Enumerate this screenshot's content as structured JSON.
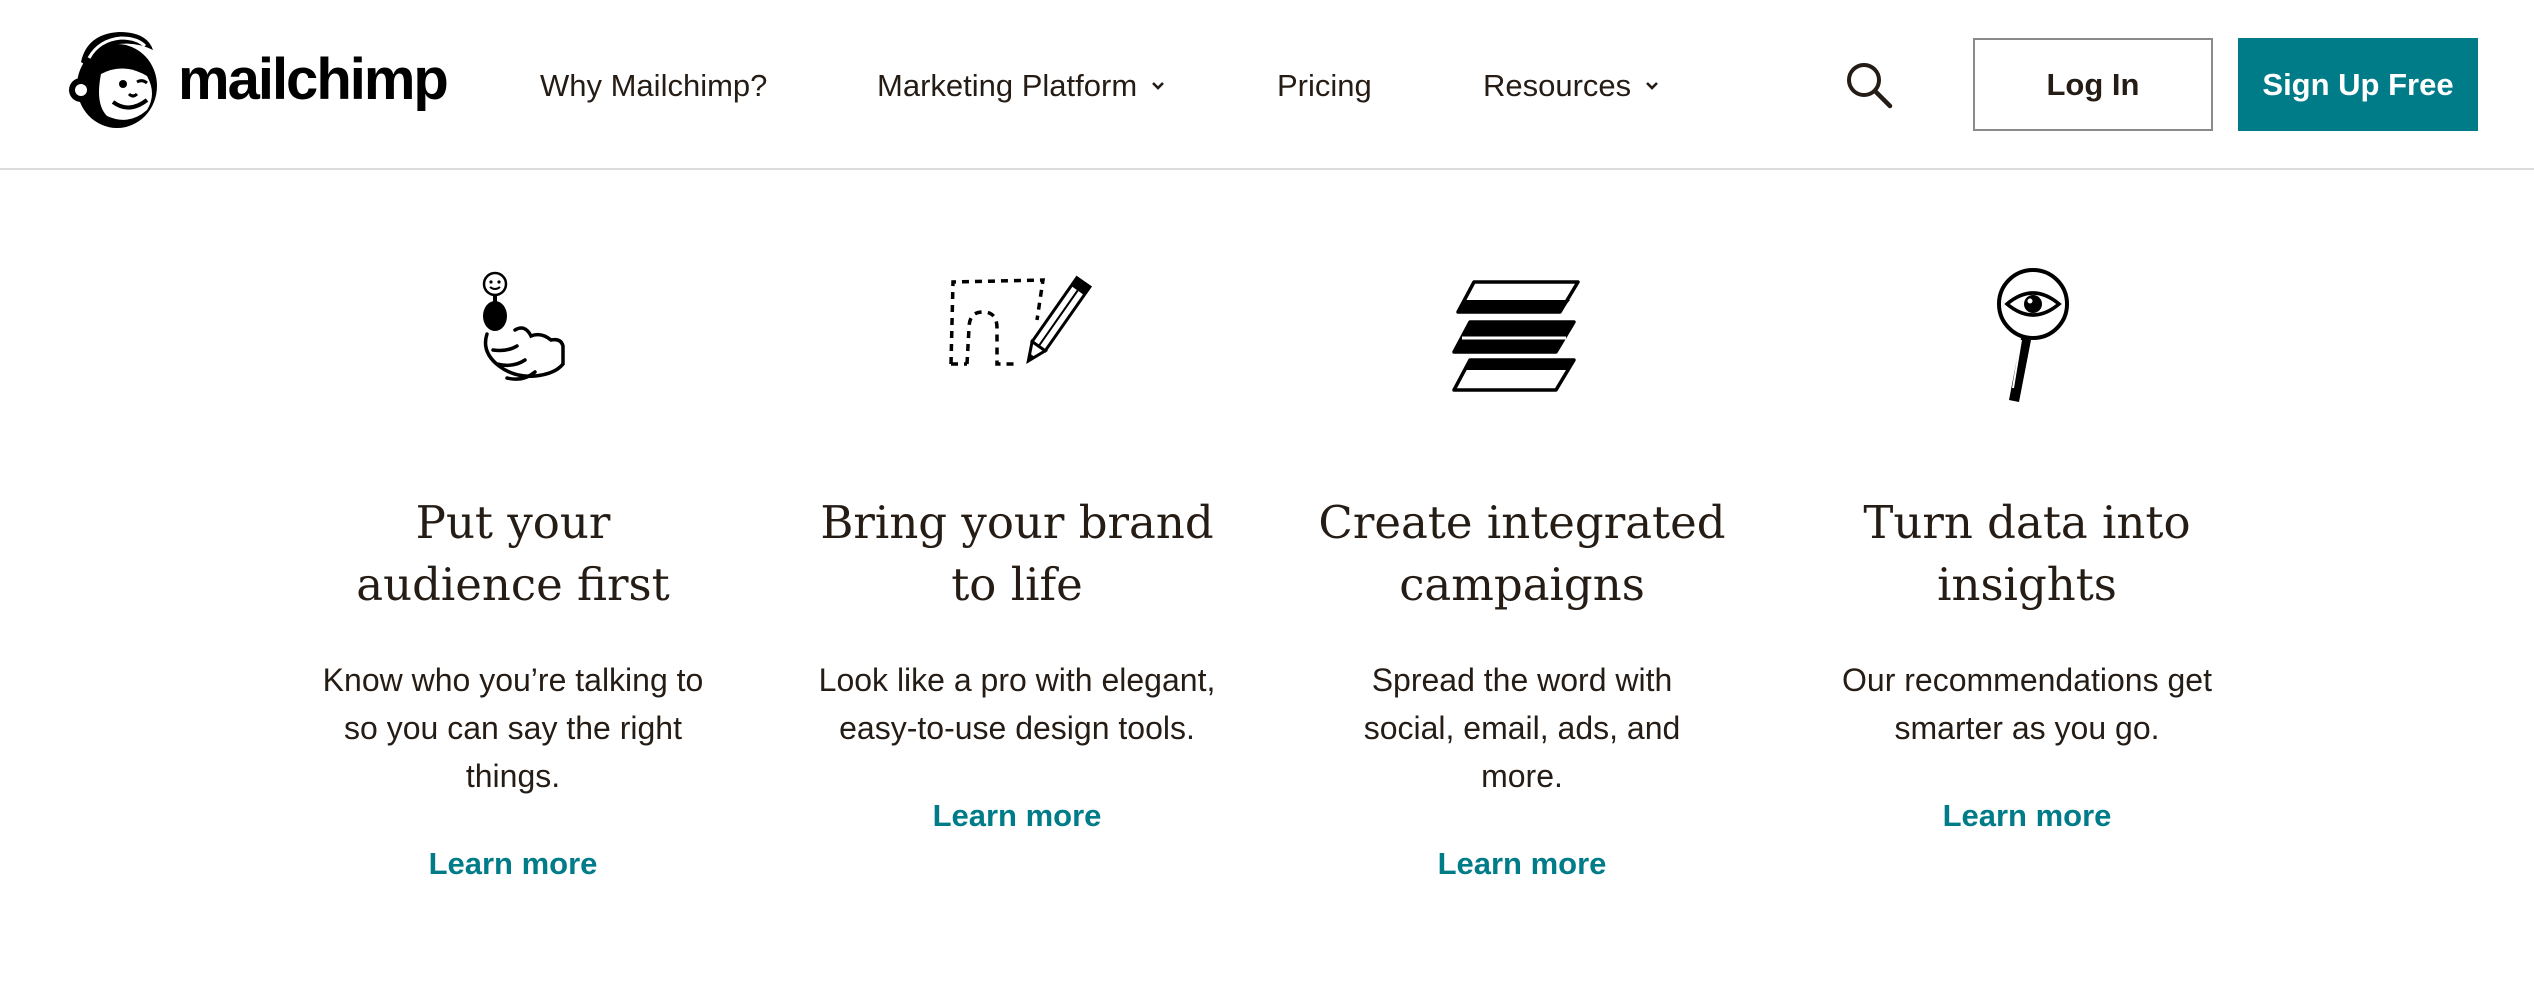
{
  "brand": {
    "name": "mailchimp",
    "accent_color": "#007c89",
    "logo_icon": "freddie-monkey-icon"
  },
  "nav": {
    "items": [
      {
        "label": "Why Mailchimp?",
        "has_dropdown": false
      },
      {
        "label": "Marketing Platform",
        "has_dropdown": true
      },
      {
        "label": "Pricing",
        "has_dropdown": false
      },
      {
        "label": "Resources",
        "has_dropdown": true
      }
    ],
    "search_icon": "search-icon",
    "login_label": "Log In",
    "signup_label": "Sign Up Free"
  },
  "features": [
    {
      "icon": "audience-hand-icon",
      "title_line1": "Put your",
      "title_line2": "audience first",
      "body": "Know who you’re talking to so you can say the right things.",
      "link": "Learn more"
    },
    {
      "icon": "pencil-dotted-path-icon",
      "title_line1": "Bring your brand",
      "title_line2": "to life",
      "body": "Look like a pro with elegant, easy-to-use design tools.",
      "link": "Learn more"
    },
    {
      "icon": "stacked-layers-icon",
      "title_line1": "Create integrated",
      "title_line2": "campaigns",
      "body": "Spread the word with social, email, ads, and more.",
      "link": "Learn more"
    },
    {
      "icon": "magnifier-eye-icon",
      "title_line1": "Turn data into",
      "title_line2": "insights",
      "body": "Our recommendations get smarter as you go.",
      "link": "Learn more"
    }
  ]
}
